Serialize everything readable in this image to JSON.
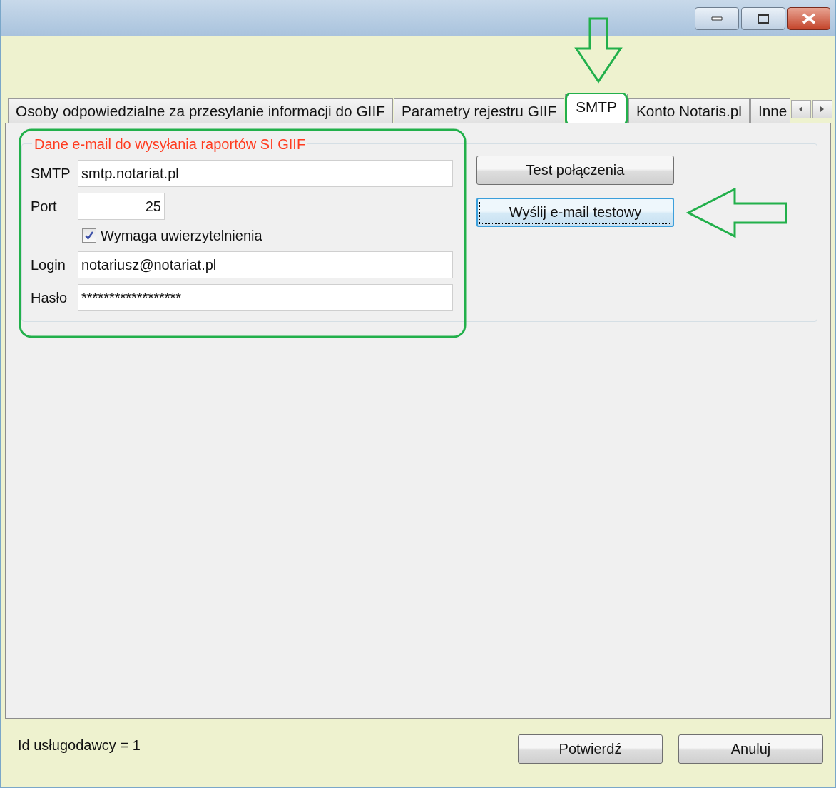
{
  "tabs": [
    {
      "label": "Osoby odpowiedzialne za przesylanie informacji do GIIF",
      "selected": false
    },
    {
      "label": "Parametry rejestru GIIF",
      "selected": false
    },
    {
      "label": "SMTP",
      "selected": true
    },
    {
      "label": "Konto Notaris.pl",
      "selected": false
    },
    {
      "label": "Inne",
      "selected": false
    }
  ],
  "group": {
    "title": "Dane e-mail do wysyłania raportów SI GIIF",
    "fields": [
      {
        "kind": "text",
        "label": "SMTP",
        "value": "smtp.notariat.pl"
      },
      {
        "kind": "number",
        "label": "Port",
        "value": "25"
      },
      {
        "kind": "checkbox",
        "label": "Wymaga uwierzytelnienia",
        "checked": true
      },
      {
        "kind": "text",
        "label": "Login",
        "value": "notariusz@notariat.pl"
      },
      {
        "kind": "text",
        "label": "Hasło",
        "value": "******************"
      }
    ]
  },
  "actions": [
    {
      "label": "Test połączenia",
      "focused": false
    },
    {
      "label": "Wyślij e-mail testowy",
      "focused": true
    }
  ],
  "footer": {
    "info": "Id usługodawcy = 1",
    "buttons": [
      "Potwierdź",
      "Anuluj"
    ]
  }
}
